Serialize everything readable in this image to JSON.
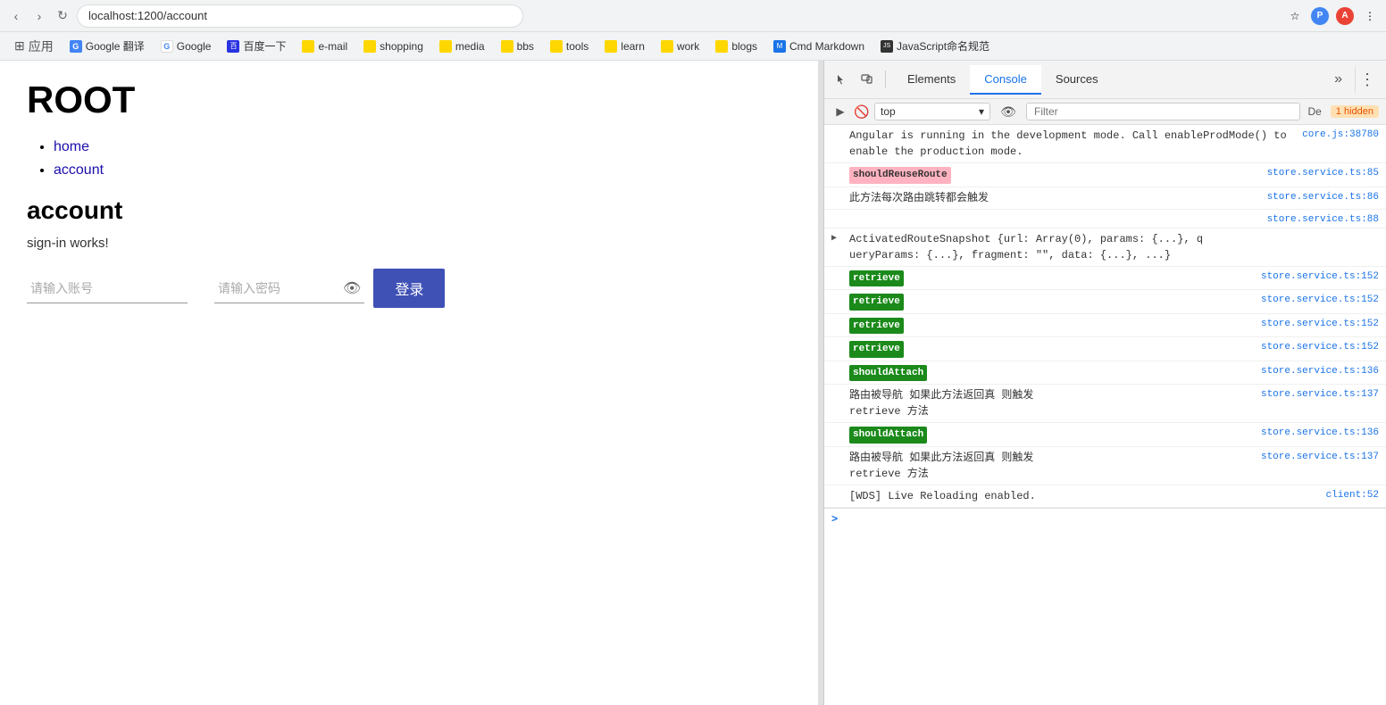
{
  "browser": {
    "address": "localhost:1200/account",
    "nav": {
      "back": "‹",
      "forward": "›",
      "reload": "↻",
      "home": "⌂"
    }
  },
  "bookmarks": [
    {
      "id": "apps",
      "label": "应用",
      "icon": "⊞",
      "color": ""
    },
    {
      "id": "google-translate",
      "label": "Google 翻译",
      "icon": "G",
      "color": "#4285f4"
    },
    {
      "id": "google",
      "label": "Google",
      "icon": "G",
      "color": "#4285f4"
    },
    {
      "id": "baidu",
      "label": "百度一下",
      "icon": "百",
      "color": "#2932e1"
    },
    {
      "id": "email",
      "label": "e-mail",
      "icon": "✉",
      "color": "#ffd700"
    },
    {
      "id": "shopping",
      "label": "shopping",
      "icon": "🛍",
      "color": "#ffd700"
    },
    {
      "id": "media",
      "label": "media",
      "icon": "▶",
      "color": "#ffd700"
    },
    {
      "id": "bbs",
      "label": "bbs",
      "icon": "💬",
      "color": "#ffd700"
    },
    {
      "id": "tools",
      "label": "tools",
      "icon": "🔧",
      "color": "#ffd700"
    },
    {
      "id": "learn",
      "label": "learn",
      "icon": "📚",
      "color": "#ffd700"
    },
    {
      "id": "work",
      "label": "work",
      "icon": "💼",
      "color": "#ffd700"
    },
    {
      "id": "blogs",
      "label": "blogs",
      "icon": "📝",
      "color": "#ffd700"
    },
    {
      "id": "cmd-markdown",
      "label": "Cmd Markdown",
      "icon": "M",
      "color": "#1a73e8"
    },
    {
      "id": "js-naming",
      "label": "JavaScript命名规范",
      "icon": "JS",
      "color": "#333"
    }
  ],
  "page": {
    "title": "ROOT",
    "nav_items": [
      {
        "label": "home",
        "href": "#home"
      },
      {
        "label": "account",
        "href": "#account"
      }
    ],
    "section_title": "account",
    "section_subtitle": "sign-in works!",
    "form": {
      "username_placeholder": "请输入账号",
      "password_placeholder": "请输入密码",
      "submit_label": "登录"
    }
  },
  "devtools": {
    "tabs": [
      {
        "id": "elements",
        "label": "Elements",
        "active": false
      },
      {
        "id": "console",
        "label": "Console",
        "active": true
      },
      {
        "id": "sources",
        "label": "Sources",
        "active": false
      }
    ],
    "more_tabs_label": "»",
    "options_label": "⋮",
    "console": {
      "context": "top",
      "filter_placeholder": "Filter",
      "default_levels": "De",
      "hidden_count": "1 hidden",
      "messages": [
        {
          "type": "info",
          "text": "Angular is running in the development\nmode. Call enableProdMode() to enable the production\nmode.",
          "source": "core.js:38780",
          "has_triangle": false
        },
        {
          "type": "info",
          "badge": "shouldReuseRoute",
          "badge_class": "badge-pink",
          "text": "",
          "source": "store.service.ts:85",
          "has_triangle": false
        },
        {
          "type": "info",
          "text": "此方法每次路由跳转都会触发",
          "source": "store.service.ts:86",
          "has_triangle": false
        },
        {
          "type": "info",
          "text": "",
          "source": "store.service.ts:88",
          "has_triangle": false
        },
        {
          "type": "info",
          "triangle": "▶",
          "text": "ActivatedRouteSnapshot {url: Array(0), params: {...}, q\nueryParams: {...}, fragment: \"\", data: {...}, ...}",
          "source": "",
          "has_triangle": true
        },
        {
          "type": "info",
          "badge": "retrieve",
          "badge_class": "badge-green",
          "text": "",
          "source": "store.service.ts:152"
        },
        {
          "type": "info",
          "badge": "retrieve",
          "badge_class": "badge-green",
          "text": "",
          "source": "store.service.ts:152"
        },
        {
          "type": "info",
          "badge": "retrieve",
          "badge_class": "badge-green",
          "text": "",
          "source": "store.service.ts:152"
        },
        {
          "type": "info",
          "badge": "retrieve",
          "badge_class": "badge-green",
          "text": "",
          "source": "store.service.ts:152"
        },
        {
          "type": "info",
          "badge": "shouldAttach",
          "badge_class": "badge-green",
          "text": "",
          "source": "store.service.ts:136"
        },
        {
          "type": "info",
          "text": "路由被导航 如果此方法返回真 则触发\nretrieve 方法",
          "source": "store.service.ts:137"
        },
        {
          "type": "info",
          "badge": "shouldAttach",
          "badge_class": "badge-green",
          "text": "",
          "source": "store.service.ts:136"
        },
        {
          "type": "info",
          "text": "路由被导航 如果此方法返回真 则触发\nretrieve 方法",
          "source": "store.service.ts:137"
        },
        {
          "type": "info",
          "text": "[WDS] Live Reloading enabled.",
          "source": "client:52"
        }
      ],
      "prompt_symbol": ">"
    }
  }
}
